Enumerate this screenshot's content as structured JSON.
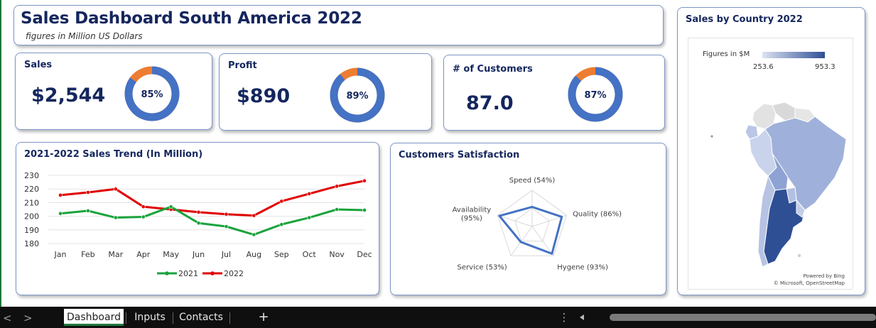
{
  "header": {
    "title": "Sales Dashboard South America 2022",
    "subtitle": "figures in Million US Dollars"
  },
  "kpis": [
    {
      "label": "Sales",
      "value": "$2,544",
      "percent_label": "85%",
      "percent": 85
    },
    {
      "label": "Profit",
      "value": "$890",
      "percent_label": "89%",
      "percent": 89
    },
    {
      "label": "# of Customers",
      "value": "87.0",
      "percent_label": "87%",
      "percent": 87
    }
  ],
  "colors": {
    "title": "#14265e",
    "donut_main": "#4472c4",
    "donut_rest": "#ed7d31",
    "series_2021": "#1aa33c",
    "series_2022": "#e00000",
    "map_dark": "#2f4f94",
    "map_light": "#dde3f2"
  },
  "trend": {
    "title": "2021-2022 Sales Trend (In Million)"
  },
  "satisfaction": {
    "title": "Customers Satisfaction"
  },
  "map": {
    "title": "Sales by Country 2022",
    "legend_title": "Figures in $M",
    "legend_min": "253.6",
    "legend_max": "953.3",
    "powered": "Powered by Bing",
    "copyright": "© Microsoft, OpenStreetMap"
  },
  "chart_data": [
    {
      "type": "line",
      "title": "2021-2022 Sales Trend (In Million)",
      "categories": [
        "Jan",
        "Feb",
        "Mar",
        "Apr",
        "May",
        "Jun",
        "Jul",
        "Aug",
        "Sep",
        "Oct",
        "Nov",
        "Dec"
      ],
      "series": [
        {
          "name": "2021",
          "values": [
            202,
            204,
            199,
            199.5,
            207,
            195,
            192.5,
            186.5,
            194,
            199,
            205,
            204.5
          ]
        },
        {
          "name": "2022",
          "values": [
            215.5,
            217.5,
            220,
            207,
            205,
            203,
            201.5,
            200.5,
            211,
            216.5,
            222,
            226
          ]
        }
      ],
      "y_ticks": [
        "180",
        "190",
        "200",
        "210",
        "220",
        "230"
      ],
      "ylim": [
        180,
        230
      ],
      "grid": true,
      "legend_position": "bottom"
    },
    {
      "type": "radar",
      "title": "Customers Satisfaction",
      "axes": [
        {
          "label": "Speed (54%)",
          "value": 54
        },
        {
          "label": "Quality (86%)",
          "value": 86
        },
        {
          "label": "Hygene (93%)",
          "value": 93
        },
        {
          "label": "Service (53%)",
          "value": 53
        },
        {
          "label": "Availability (95%)",
          "value": 95
        }
      ],
      "rmax": 100
    }
  ],
  "tabs": {
    "items": [
      {
        "label": "Dashboard",
        "active": true
      },
      {
        "label": "Inputs",
        "active": false
      },
      {
        "label": "Contacts",
        "active": false
      }
    ],
    "add_symbol": "+",
    "more_symbol": "⋮",
    "prev_symbol": "<",
    "next_symbol": ">"
  }
}
